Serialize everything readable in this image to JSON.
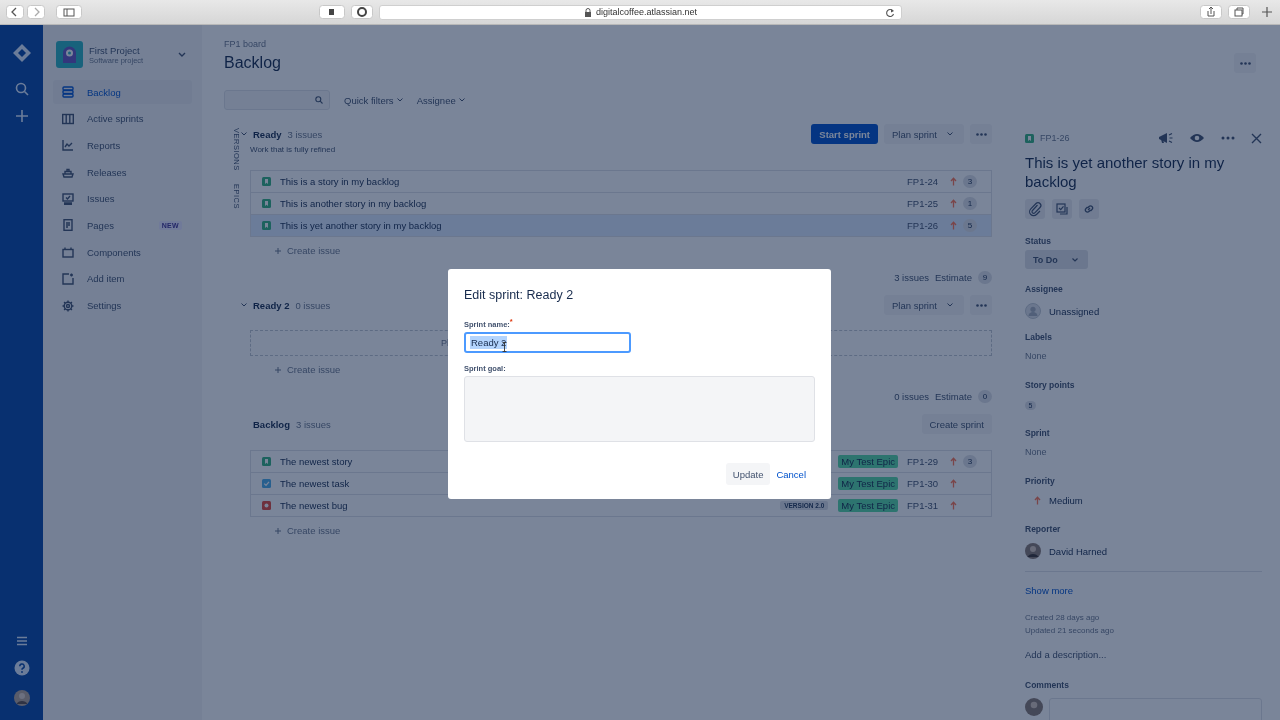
{
  "browser": {
    "url": "digitalcoffee.atlassian.net"
  },
  "project": {
    "name": "First Project",
    "type": "Software project"
  },
  "sidebar": {
    "items": [
      {
        "label": "Backlog",
        "selected": true
      },
      {
        "label": "Active sprints",
        "selected": false
      },
      {
        "label": "Reports",
        "selected": false
      },
      {
        "label": "Releases",
        "selected": false
      },
      {
        "label": "Issues",
        "selected": false
      },
      {
        "label": "Pages",
        "selected": false,
        "badge": "NEW"
      },
      {
        "label": "Components",
        "selected": false
      },
      {
        "label": "Add item",
        "selected": false
      },
      {
        "label": "Settings",
        "selected": false
      }
    ]
  },
  "board": {
    "breadcrumb": "FP1 board",
    "title": "Backlog",
    "filters": [
      "Quick filters",
      "Assignee"
    ],
    "side_tabs": [
      "VERSIONS",
      "EPICS"
    ]
  },
  "sprints": [
    {
      "name": "Ready",
      "count": "3 issues",
      "goal": "Work that is fully refined",
      "actions": [
        {
          "kind": "primary",
          "label": "Start sprint"
        },
        {
          "kind": "dropdown",
          "label": "Plan sprint"
        },
        {
          "kind": "more"
        }
      ],
      "issues": [
        {
          "kind": "story",
          "summary": "This is a story in my backlog",
          "key": "FP1-24",
          "points": "3",
          "selected": false
        },
        {
          "kind": "story",
          "summary": "This is another story in my backlog",
          "key": "FP1-25",
          "points": "1",
          "selected": false
        },
        {
          "kind": "story",
          "summary": "This is yet another story in my backlog",
          "key": "FP1-26",
          "points": "5",
          "selected": true
        }
      ],
      "create": "Create issue",
      "footer": {
        "issues": "3 issues",
        "estimate_label": "Estimate",
        "estimate": "9"
      }
    },
    {
      "name": "Ready 2",
      "count": "0 issues",
      "actions": [
        {
          "kind": "dropdown",
          "label": "Plan sprint"
        },
        {
          "kind": "more"
        }
      ],
      "empty_text": "Pl",
      "create": "Create issue",
      "footer": {
        "issues": "0 issues",
        "estimate_label": "Estimate",
        "estimate": "0"
      }
    },
    {
      "name": "Backlog",
      "count": "3 issues",
      "actions": [
        {
          "kind": "plain",
          "label": "Create sprint"
        }
      ],
      "issues": [
        {
          "kind": "story",
          "summary": "The newest story",
          "epic": "My Test Epic",
          "key": "FP1-29",
          "points": "3",
          "selected": false
        },
        {
          "kind": "task",
          "summary": "The newest task",
          "epic": "My Test Epic",
          "key": "FP1-30",
          "selected": false
        },
        {
          "kind": "bug",
          "summary": "The newest bug",
          "version": "VERSION 2.0",
          "epic": "My Test Epic",
          "key": "FP1-31",
          "selected": false
        }
      ],
      "create": "Create issue"
    }
  ],
  "detail": {
    "key": "FP1-26",
    "title": "This is yet another story in my backlog",
    "fields": [
      {
        "kind": "status",
        "label": "Status",
        "value": "To Do"
      },
      {
        "kind": "unassigned",
        "label": "Assignee",
        "value": "Unassigned"
      },
      {
        "kind": "none",
        "label": "Labels",
        "value": "None"
      },
      {
        "kind": "points",
        "label": "Story points",
        "value": "5"
      },
      {
        "kind": "none",
        "label": "Sprint",
        "value": "None"
      },
      {
        "kind": "priority",
        "label": "Priority",
        "value": "Medium"
      },
      {
        "kind": "person",
        "label": "Reporter",
        "value": "David Harned"
      }
    ],
    "show_more": "Show more",
    "created": "Created 28 days ago",
    "updated": "Updated 21 seconds ago",
    "description": "Add a description...",
    "comments": "Comments"
  },
  "dialog": {
    "title": "Edit sprint: Ready 2",
    "name_label": "Sprint name:",
    "required": "*",
    "name_value": "Ready 2",
    "value_selected": true,
    "goal_label": "Sprint goal:",
    "buttons": [
      {
        "kind": "default",
        "label": "Update"
      },
      {
        "kind": "link",
        "label": "Cancel"
      }
    ]
  }
}
